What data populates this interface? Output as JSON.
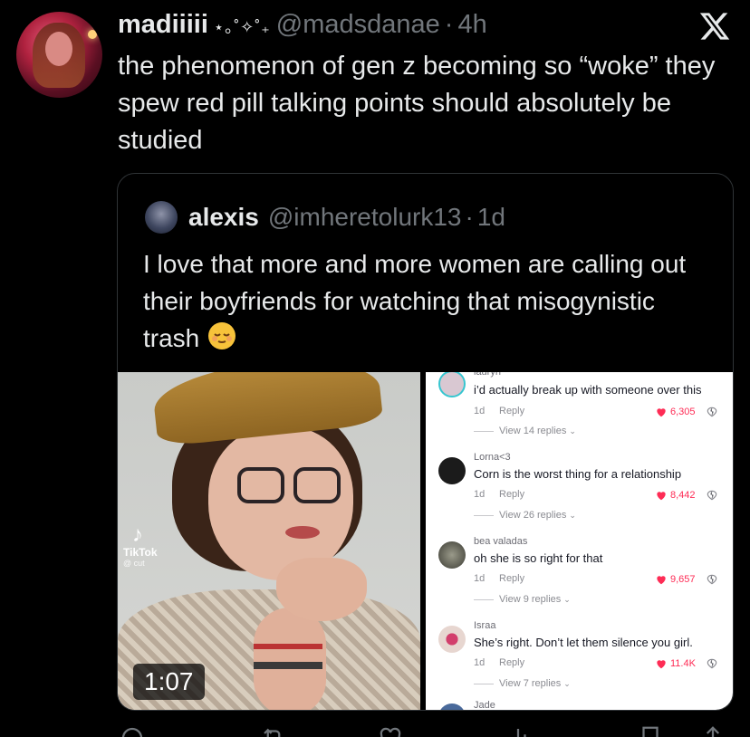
{
  "tweet": {
    "author_name": "madiiiii",
    "author_name_deco": "⋆｡˚✧˚₊",
    "handle": "@madsdanae",
    "separator": "·",
    "time": "4h",
    "text": "the phenomenon of gen z becoming so “woke” they spew red pill talking points should absolutely be studied"
  },
  "quote": {
    "author_name": "alexis",
    "handle": "@imheretolurk13",
    "separator": "·",
    "time": "1d",
    "text": "I love that more and more women are calling out their boyfriends for watching that misogynistic trash",
    "emoji": "relieved-face-emoji",
    "media": {
      "video_duration": "1:07",
      "watermark_brand": "TikTok",
      "watermark_user": "@ cut"
    },
    "comments": [
      {
        "user": "lauryn",
        "text": "i’d actually break up with someone over this",
        "age": "1d",
        "reply_label": "Reply",
        "likes": "6,305",
        "view_replies": "View 14 replies"
      },
      {
        "user": "Lorna<3",
        "text": "Corn is the worst thing for a relationship",
        "age": "1d",
        "reply_label": "Reply",
        "likes": "8,442",
        "view_replies": "View 26 replies"
      },
      {
        "user": "bea valadas",
        "text": "oh she is so right for that",
        "age": "1d",
        "reply_label": "Reply",
        "likes": "9,657",
        "view_replies": "View 9 replies"
      },
      {
        "user": "Israa",
        "text": "She’s right. Don’t let them silence you girl.",
        "age": "1d",
        "reply_label": "Reply",
        "likes": "11.4K",
        "view_replies": "View 7 replies"
      },
      {
        "user": "Jade",
        "text": "",
        "age": "",
        "reply_label": "",
        "likes": "",
        "view_replies": ""
      }
    ]
  },
  "icons": {
    "platform_logo": "x-logo-icon",
    "reply": "reply-icon",
    "retweet": "retweet-icon",
    "like": "like-icon",
    "views": "views-icon",
    "bookmark": "bookmark-icon",
    "share": "share-icon"
  },
  "colors": {
    "background": "#000000",
    "text_primary": "#e7e9ea",
    "text_secondary": "#71767b",
    "border": "#2f3336",
    "tiktok_like": "#fe2c55"
  }
}
